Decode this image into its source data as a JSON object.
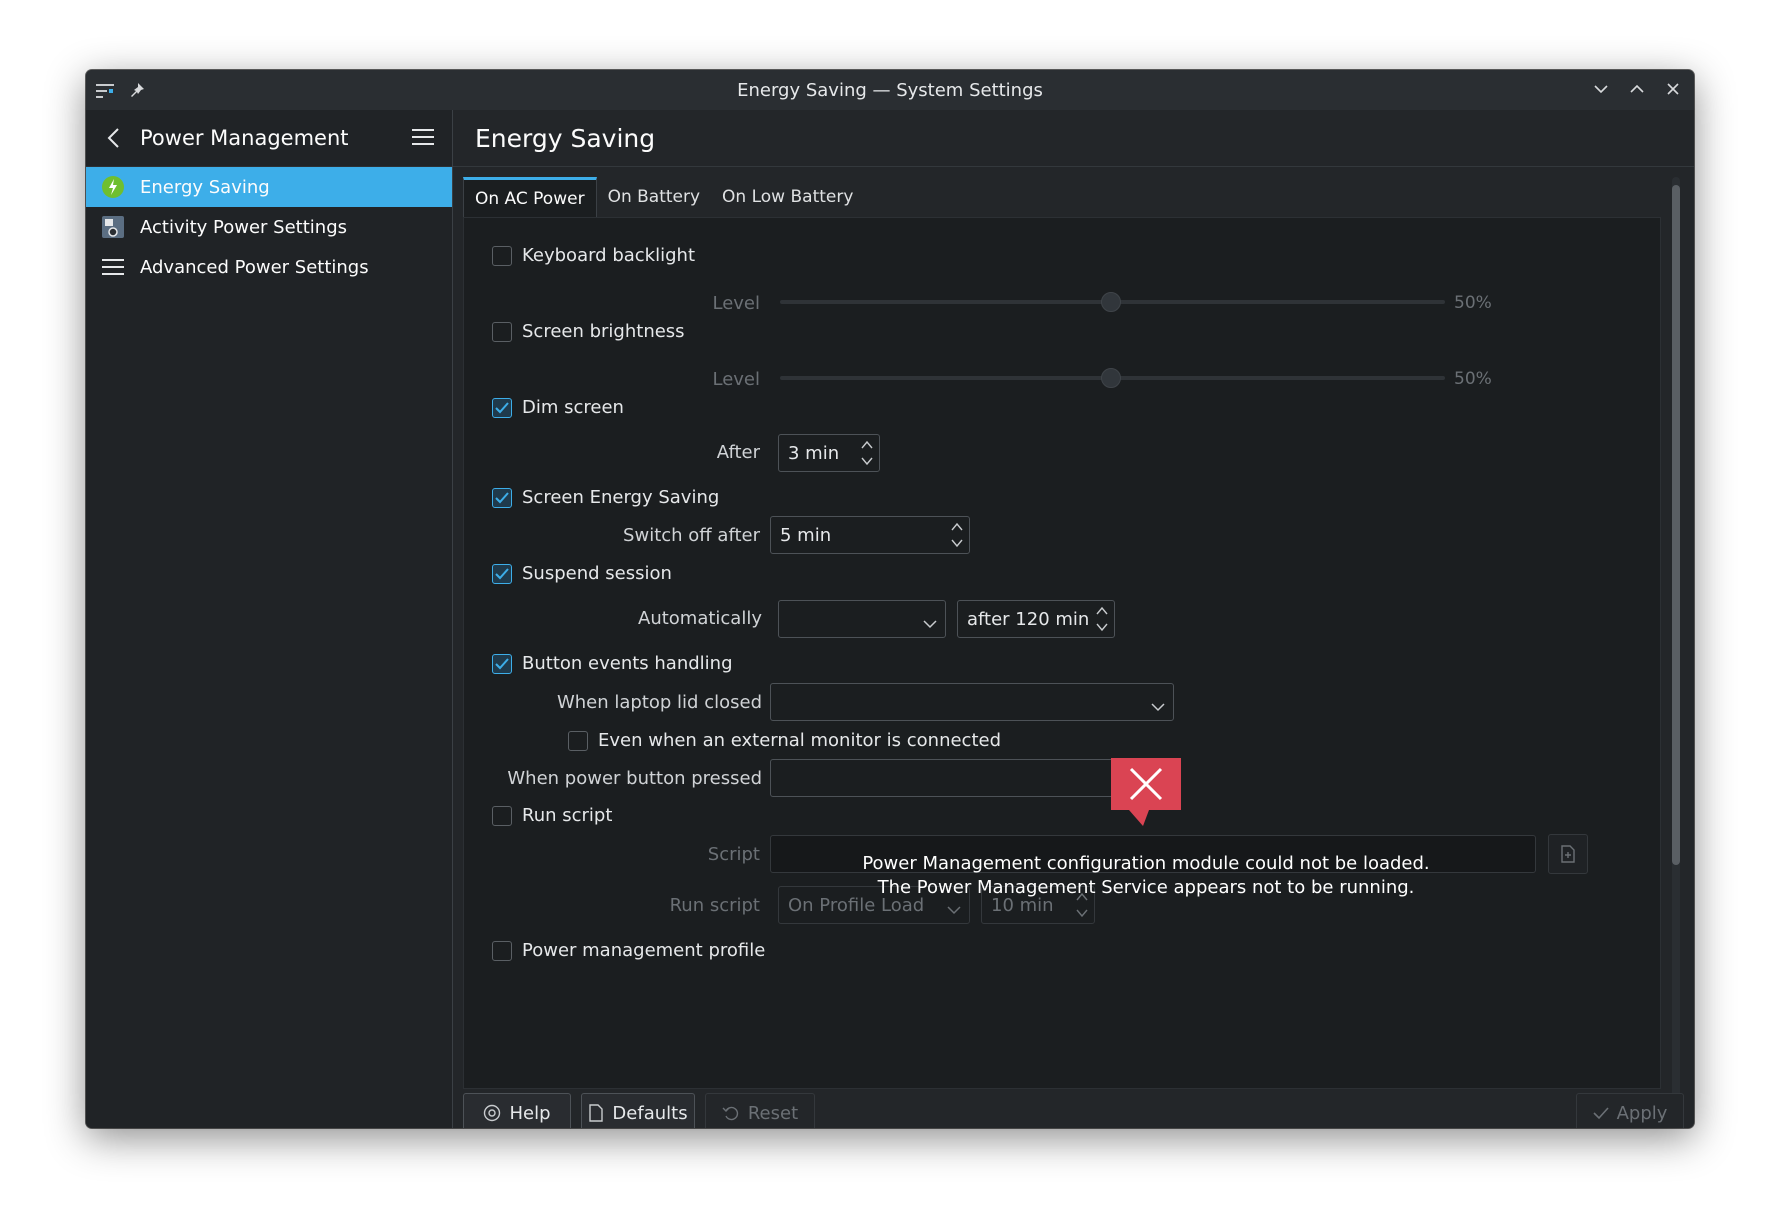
{
  "window": {
    "title": "Energy Saving — System Settings"
  },
  "sidebar": {
    "header": "Power Management",
    "items": [
      {
        "label": "Energy Saving",
        "icon": "energy-saving-icon",
        "active": true
      },
      {
        "label": "Activity Power Settings",
        "icon": "activity-icon",
        "active": false
      },
      {
        "label": "Advanced Power Settings",
        "icon": "list-icon",
        "active": false
      }
    ]
  },
  "main": {
    "title": "Energy Saving",
    "tabs": [
      "On AC Power",
      "On Battery",
      "On Low Battery"
    ],
    "keyboard_backlight": {
      "label": "Keyboard backlight",
      "checked": false,
      "level_label": "Level",
      "level_value": "50%"
    },
    "screen_brightness": {
      "label": "Screen brightness",
      "checked": false,
      "level_label": "Level",
      "level_value": "50%"
    },
    "dim_screen": {
      "label": "Dim screen",
      "checked": true,
      "after_label": "After",
      "after_value": "3 min"
    },
    "screen_energy_saving": {
      "label": "Screen Energy Saving",
      "checked": true,
      "switch_label": "Switch off after",
      "switch_value": "5 min"
    },
    "suspend_session": {
      "label": "Suspend session",
      "checked": true,
      "auto_label": "Automatically",
      "auto_value": "",
      "after_value": "after 120 min"
    },
    "button_events": {
      "label": "Button events handling",
      "checked": true,
      "lid_label": "When laptop lid closed",
      "lid_value": "",
      "external_monitor_label": "Even when an external monitor is connected",
      "external_monitor_checked": false,
      "power_button_label": "When power button pressed",
      "power_button_value": ""
    },
    "run_script": {
      "label": "Run script",
      "checked": false,
      "script_label": "Script",
      "script_value": "",
      "run_label": "Run script",
      "run_value": "On Profile Load",
      "run_time": "10 min"
    },
    "power_profile": {
      "label": "Power management profile",
      "checked": false
    }
  },
  "footer": {
    "help": "Help",
    "defaults": "Defaults",
    "reset": "Reset",
    "apply": "Apply"
  },
  "error": {
    "line1": "Power Management configuration module could not be loaded.",
    "line2": "The Power Management Service appears not to be running."
  },
  "colors": {
    "accent": "#3daee9",
    "error": "#da4453",
    "background": "#1b1e20"
  }
}
